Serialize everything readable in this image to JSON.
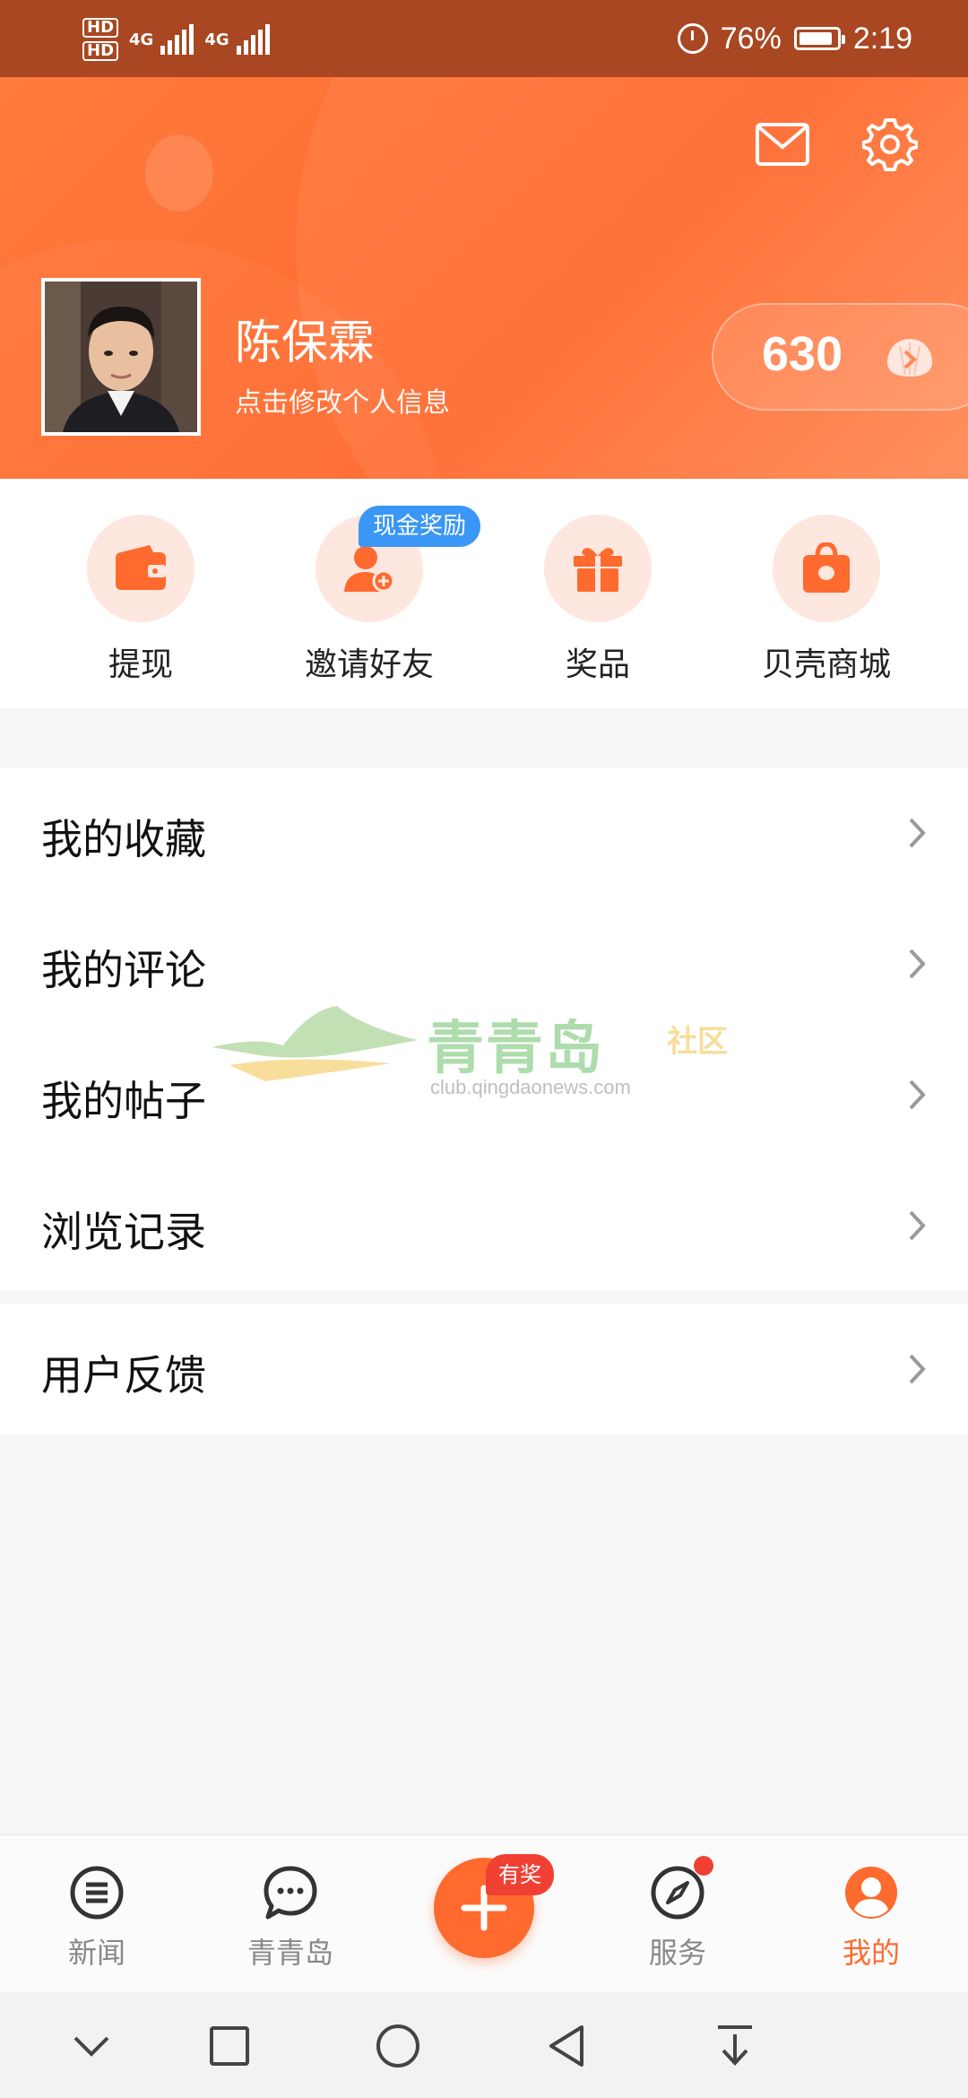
{
  "status_bar": {
    "sim1": "HD",
    "sim2": "HD",
    "net1": "4G",
    "net2": "4G",
    "battery": "76%",
    "time": "2:19"
  },
  "header": {
    "mail_icon": "mail-icon",
    "settings_icon": "gear-icon",
    "username": "陈保霖",
    "edit_hint": "点击修改个人信息",
    "points": "630"
  },
  "quick_actions": {
    "items": [
      {
        "label": "提现",
        "icon": "wallet-icon"
      },
      {
        "label": "邀请好友",
        "icon": "add-user-icon"
      },
      {
        "label": "奖品",
        "icon": "gift-icon"
      },
      {
        "label": "贝壳商城",
        "icon": "shopping-bag-icon"
      }
    ],
    "invite_badge": "现金奖励"
  },
  "menu": {
    "items": [
      {
        "label": "我的收藏"
      },
      {
        "label": "我的评论"
      },
      {
        "label": "我的帖子"
      },
      {
        "label": "浏览记录"
      }
    ],
    "feedback": {
      "label": "用户反馈"
    }
  },
  "watermark": {
    "name": "青青岛",
    "suffix": "社区",
    "url": "club.qingdaonews.com"
  },
  "bottom_nav": {
    "items": [
      {
        "label": "新闻",
        "icon": "menu-list-icon"
      },
      {
        "label": "青青岛",
        "icon": "chat-bubble-icon"
      },
      {
        "label": "服务",
        "icon": "compass-icon"
      },
      {
        "label": "我的",
        "icon": "person-icon"
      }
    ],
    "fab_badge": "有奖",
    "active": "我的",
    "active_color": "#ff6a2e"
  },
  "colors": {
    "accent": "#ff6a2e",
    "status_bar": "#a84721",
    "badge_blue": "#3a97f5",
    "badge_red": "#f04034"
  }
}
